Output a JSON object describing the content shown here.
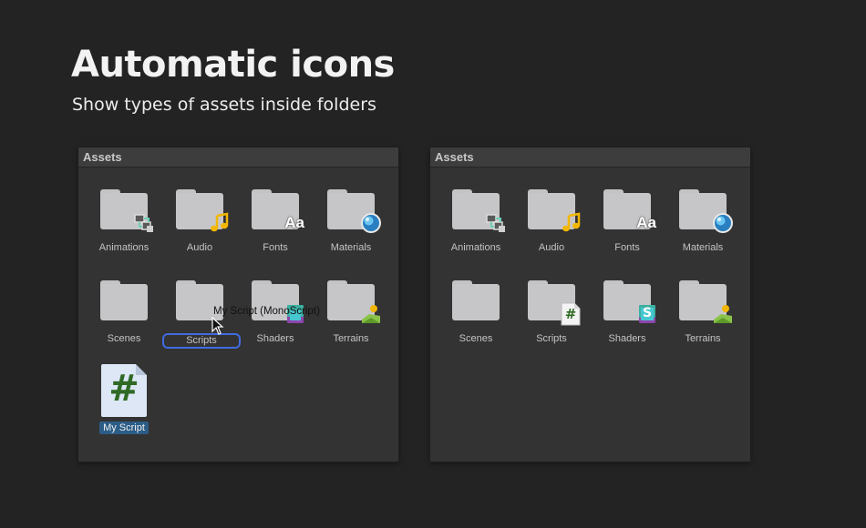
{
  "hero": {
    "title": "Automatic icons",
    "subtitle": "Show types of assets inside folders"
  },
  "left_panel": {
    "header": "Assets",
    "folders": [
      {
        "label": "Animations",
        "badge": "animator-icon"
      },
      {
        "label": "Audio",
        "badge": "music-note-icon"
      },
      {
        "label": "Fonts",
        "badge": "font-icon",
        "badge_text": "Aa"
      },
      {
        "label": "Materials",
        "badge": "material-sphere-icon"
      },
      {
        "label": "Scenes",
        "badge": "none"
      },
      {
        "label": "Scripts",
        "badge": "none",
        "state": "drop-target"
      },
      {
        "label": "Shaders",
        "badge": "shader-icon"
      },
      {
        "label": "Terrains",
        "badge": "terrain-icon"
      }
    ],
    "script_asset": {
      "label": "My Script",
      "glyph": "#",
      "state": "selected"
    },
    "drag_tooltip": "My Script (MonoScript)"
  },
  "right_panel": {
    "header": "Assets",
    "folders": [
      {
        "label": "Animations",
        "badge": "animator-icon"
      },
      {
        "label": "Audio",
        "badge": "music-note-icon"
      },
      {
        "label": "Fonts",
        "badge": "font-icon",
        "badge_text": "Aa"
      },
      {
        "label": "Materials",
        "badge": "material-sphere-icon"
      },
      {
        "label": "Scenes",
        "badge": "none"
      },
      {
        "label": "Scripts",
        "badge": "script-icon",
        "badge_text": "#"
      },
      {
        "label": "Shaders",
        "badge": "shader-icon",
        "badge_text": "S"
      },
      {
        "label": "Terrains",
        "badge": "terrain-icon"
      }
    ]
  },
  "colors": {
    "background": "#232324",
    "panel": "#333334",
    "folder": "#c6c6c8",
    "selection": "#2c5d87",
    "rename_outline": "#3f6be0",
    "script_hash": "#2f6a24"
  }
}
